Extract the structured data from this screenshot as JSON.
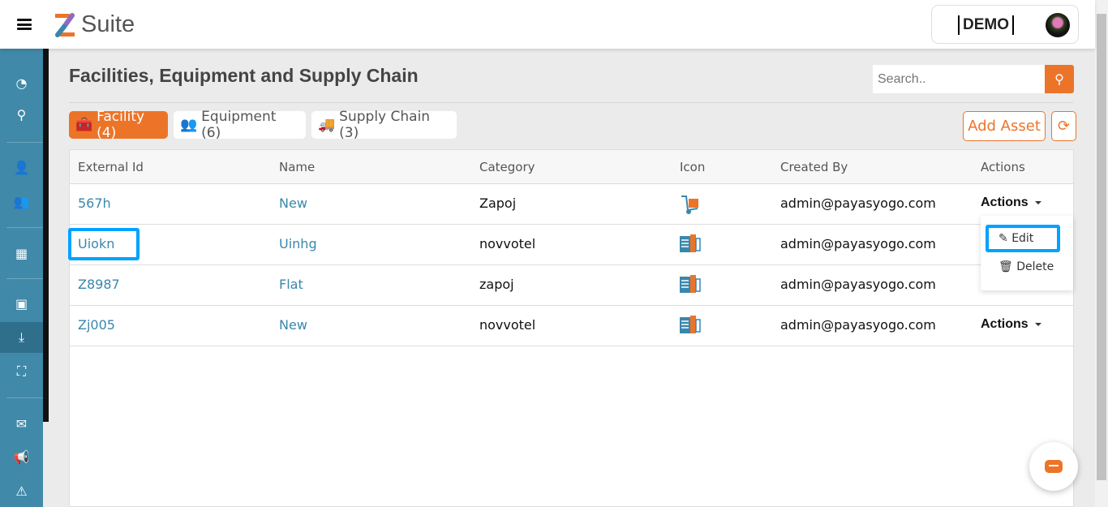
{
  "header": {
    "app_name": "Suite",
    "demo_label": "DEMO"
  },
  "page": {
    "title": "Facilities, Equipment and Supply Chain"
  },
  "search": {
    "placeholder": "Search.."
  },
  "tabs": [
    {
      "label": "Facility (4)",
      "active": true
    },
    {
      "label": "Equipment (6)"
    },
    {
      "label": "Supply Chain (3)"
    }
  ],
  "toolbar": {
    "add_asset": "Add Asset"
  },
  "table": {
    "columns": [
      "External Id",
      "Name",
      "Category",
      "Icon",
      "Created By",
      "Actions"
    ],
    "rows": [
      {
        "external_id": "567h",
        "name": "New",
        "category": "Zapoj",
        "icon": "hand-truck-icon",
        "created_by": "admin@payasyogo.com",
        "actions": "Actions"
      },
      {
        "external_id": "Uiokn",
        "name": "Uinhg",
        "category": "novvotel",
        "icon": "building-icon",
        "created_by": "admin@payasyogo.com",
        "actions": ""
      },
      {
        "external_id": "Z8987",
        "name": "Flat",
        "category": "zapoj",
        "icon": "building-icon",
        "created_by": "admin@payasyogo.com",
        "actions": ""
      },
      {
        "external_id": "Zj005",
        "name": "New",
        "category": "novvotel",
        "icon": "building-icon",
        "created_by": "admin@payasyogo.com",
        "actions": "Actions"
      }
    ]
  },
  "actions_menu": {
    "edit": "Edit",
    "delete": "Delete"
  },
  "colors": {
    "accent": "#ec7429",
    "sidebar": "#4089a9",
    "link": "#3a87ad",
    "highlight": "#00a2ff"
  }
}
